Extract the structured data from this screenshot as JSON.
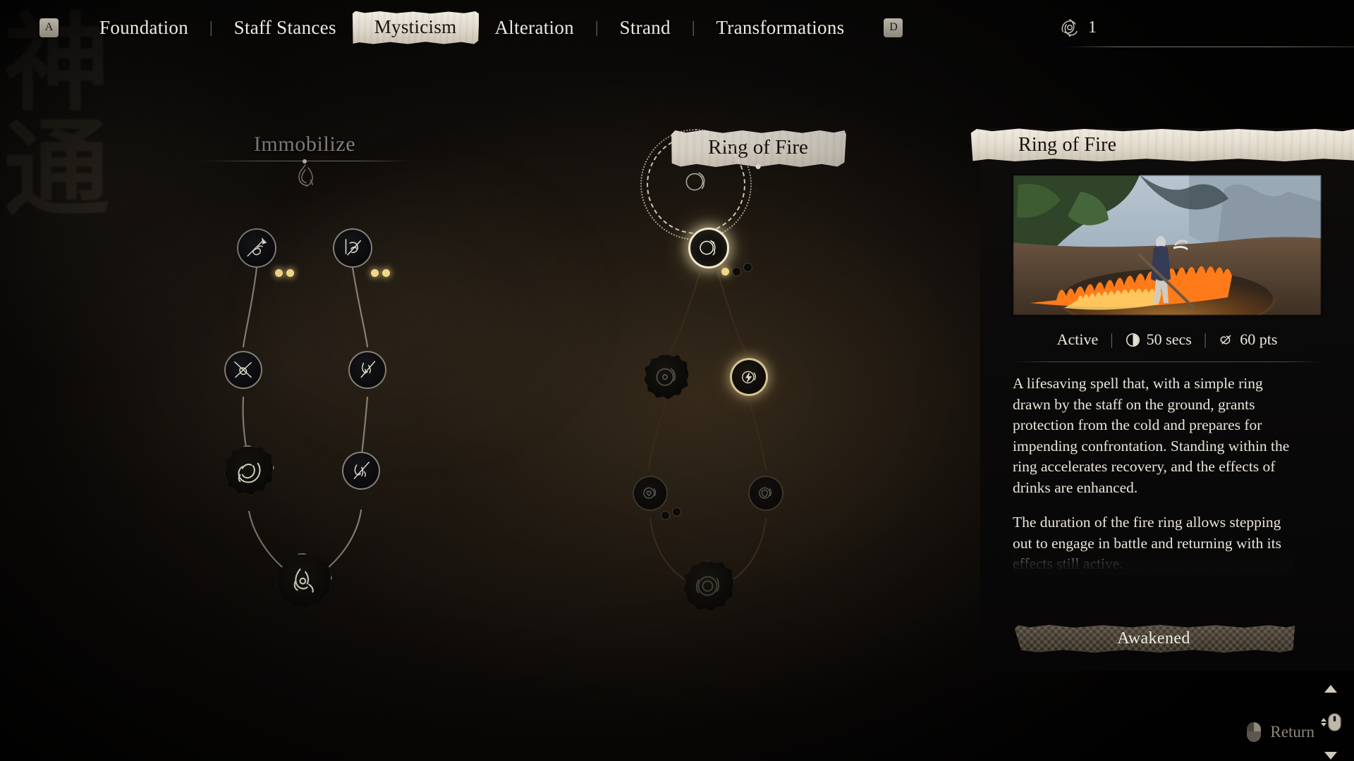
{
  "topbar": {
    "left_key": "A",
    "right_key": "D",
    "tabs": [
      {
        "label": "Foundation",
        "active": false
      },
      {
        "label": "Staff Stances",
        "active": false
      },
      {
        "label": "Mysticism",
        "active": true
      },
      {
        "label": "Alteration",
        "active": false
      },
      {
        "label": "Strand",
        "active": false
      },
      {
        "label": "Transformations",
        "active": false
      }
    ],
    "separator": "|",
    "spirit": {
      "icon": "triquetra-knot-icon",
      "count": "1"
    }
  },
  "trees": {
    "left": {
      "title": "Immobilize",
      "emblem": "flame-wisp-icon",
      "style": "dimmed-label"
    },
    "center": {
      "title": "Ring of Fire",
      "style": "banner-label"
    }
  },
  "nodes": {
    "left": [
      {
        "id": "l1",
        "icon": "staff-thrust-icon",
        "state": "unlocked",
        "pips": [
          "on",
          "on"
        ]
      },
      {
        "id": "l2",
        "icon": "staff-spin-icon",
        "state": "unlocked",
        "pips": [
          "on",
          "on"
        ]
      },
      {
        "id": "l3",
        "icon": "staff-cross-strike-icon",
        "state": "unlocked",
        "pips": []
      },
      {
        "id": "l4",
        "icon": "staff-flame-slash-icon",
        "state": "unlocked",
        "pips": []
      },
      {
        "id": "l5",
        "icon": "coiled-serpent-icon",
        "state": "unlocked-ultimate",
        "pips": []
      },
      {
        "id": "l6",
        "icon": "staff-flame-thrust-icon",
        "state": "unlocked",
        "pips": []
      },
      {
        "id": "l7",
        "icon": "immobilize-seal-icon",
        "state": "unlocked-ultimate",
        "pips": []
      }
    ],
    "center": [
      {
        "id": "c0",
        "icon": "ring-of-fire-ghost-icon",
        "state": "preview"
      },
      {
        "id": "c1",
        "icon": "ring-of-fire-icon",
        "state": "selected",
        "pips": [
          "on",
          "off",
          "off"
        ]
      },
      {
        "id": "c2",
        "icon": "fire-ring-sigil-icon",
        "state": "locked-ultimate",
        "pips": []
      },
      {
        "id": "c3",
        "icon": "fire-bolt-icon",
        "state": "highlighted",
        "pips": []
      },
      {
        "id": "c4",
        "icon": "fire-heart-icon",
        "state": "locked",
        "pips": [
          "off",
          "off"
        ]
      },
      {
        "id": "c5",
        "icon": "fire-shield-icon",
        "state": "locked",
        "pips": []
      },
      {
        "id": "c6",
        "icon": "fire-vortex-seal-icon",
        "state": "locked-ultimate",
        "pips": []
      }
    ]
  },
  "panel": {
    "title": "Ring of Fire",
    "preview_alt": "Monk drawing a burning ring with a staff in a forest clearing",
    "stats": [
      {
        "label": "Active",
        "icon": null
      },
      {
        "label": "50 secs",
        "icon": "clock-icon"
      },
      {
        "label": "60 pts",
        "icon": "mana-icon"
      }
    ],
    "stat_separator": "|",
    "description": [
      "A lifesaving spell that, with a simple ring drawn by the staff on the ground, grants protection from the cold and prepares for impending confrontation. Standing within the ring accelerates recovery, and the effects of drinks are enhanced.",
      "The duration of the fire ring allows stepping out to engage in battle and returning with its effects still active."
    ],
    "action_label": "Awakened",
    "scroll": {
      "up_icon": "chevron-up-icon",
      "down_icon": "chevron-down-icon",
      "mouse_icon": "mouse-wheel-icon"
    }
  },
  "footer": {
    "hint_icon": "mouse-right-click-icon",
    "hint_label": "Return"
  },
  "background": {
    "calligraphy": "神通",
    "accent_gold": "#f0d887",
    "parchment": "#e7e0d2",
    "text_light": "#eae4d9",
    "text_dim": "#8d867b"
  }
}
